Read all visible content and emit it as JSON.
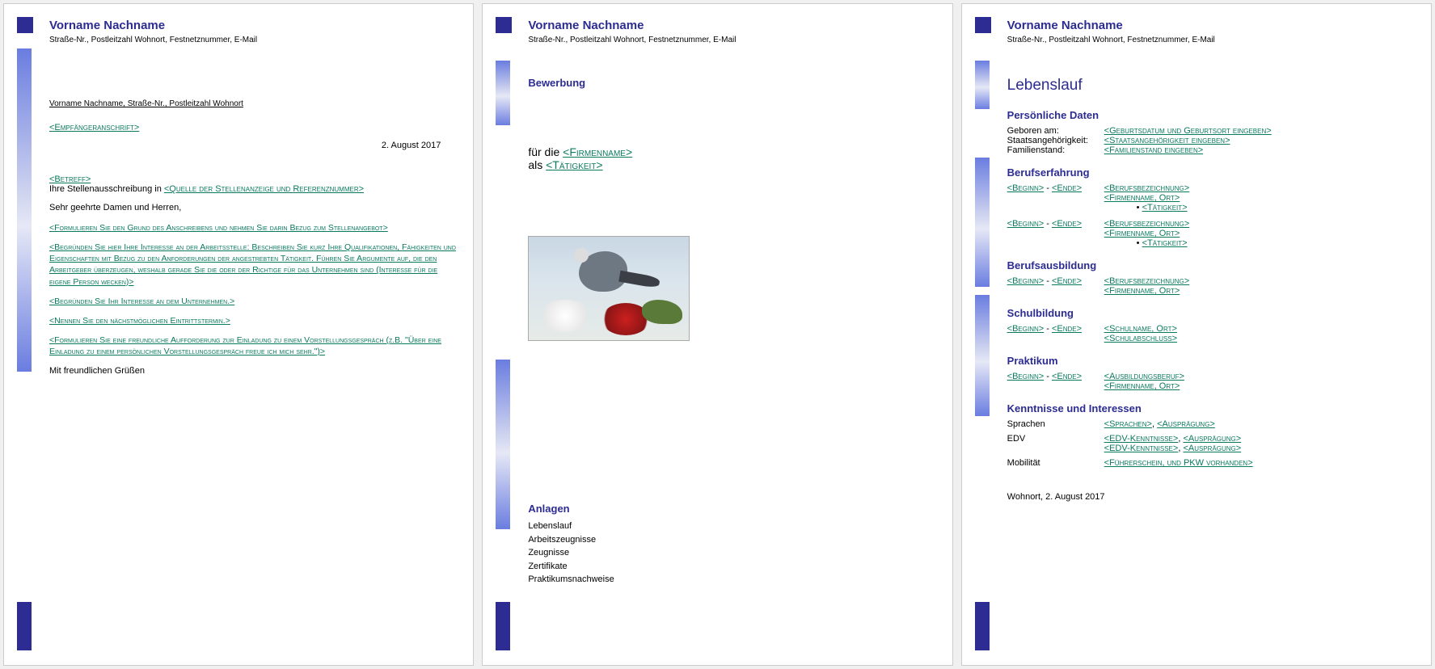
{
  "header": {
    "name": "Vorname Nachname",
    "address": "Straße-Nr., Postleitzahl  Wohnort, Festnetznummer, E-Mail"
  },
  "page1": {
    "sender_line": "Vorname Nachname, Straße-Nr., Postleitzahl  Wohnort",
    "recipient": "<Empfängeranschrift>",
    "date": "2. August 2017",
    "subject": "<Betreff>",
    "subject_line_prefix": "Ihre Stellenausschreibung in ",
    "subject_source": "<Quelle der Stellenanzeige und Referenznummer>",
    "salutation": "Sehr geehrte Damen und Herren,",
    "p1": "<Formulieren Sie den Grund des Anschreibens und nehmen Sie darin Bezug zum Stellenangebot>",
    "p2": "<Begründen Sie hier Ihre Interesse an der Arbeitsstelle: Beschreiben Sie kurz Ihre Qualifikationen, Fähigkeiten und Eigenschaften mit Bezug zu den Anforderungen der angestrebten Tätigkeit. Führen Sie Argumente auf, die den Arbeitgeber überzeugen, weshalb gerade Sie die oder der Richtige für das Unternehmen sind (Interesse für die eigene Person wecken)>",
    "p3": "<Begründen Sie Ihr Interesse an dem Unternehmen.>",
    "p4": "<Nennen Sie den nächstmöglichen Eintrittstermin.>",
    "p5": "<Formulieren Sie eine freundliche Aufforderung zur Einladung zu einem Vorstellungsgespräch (z.B. \"Über eine Einladung zu einem persönlichen Vorstellungsgespräch freue ich mich sehr.\")>",
    "closing": "Mit freundlichen Grüßen"
  },
  "page2": {
    "title": "Bewerbung",
    "for_prefix": "für die ",
    "company": "<Firmenname>",
    "as_prefix": "als ",
    "activity": "<Tätigkeit>",
    "attachments_title": "Anlagen",
    "attachments": [
      "Lebenslauf",
      "Arbeitszeugnisse",
      "Zeugnisse",
      "Zertifikate",
      "Praktikumsnachweise"
    ]
  },
  "page3": {
    "title": "Lebenslauf",
    "s_personal": "Persönliche Daten",
    "born_label": "Geboren am:",
    "born_val": "<Geburtsdatum und Geburtsort eingeben>",
    "nation_label": "Staatsangehörigkeit:",
    "nation_val": "<Staatsangehörigkeit eingeben>",
    "family_label": "Familienstand:",
    "family_val": "<Familienstand eingeben>",
    "s_experience": "Berufserfahrung",
    "beg": "<Beginn>",
    "end": "<Ende>",
    "dash": " - ",
    "job_title": "<Berufsbezeichnung>",
    "company_loc": "<Firmenname, Ort>",
    "activity": "<Tätigkeit>",
    "s_training": "Berufsausbildung",
    "s_school": "Schulbildung",
    "school_name": "<Schulname, Ort>",
    "school_degree": "<Schulabschluss>",
    "s_intern": "Praktikum",
    "intern_job": "<Ausbildungsberuf>",
    "s_skills": "Kenntnisse und Interessen",
    "lang_label": "Sprachen",
    "lang_val1": "<Sprachen>",
    "level": "<Ausprägung>",
    "edv_label": "EDV",
    "edv_val": "<EDV-Kenntnisse>",
    "mobility_label": "Mobilität",
    "mobility_val": "<Führerschein, und PKW vorhanden>",
    "footer": "Wohnort, 2. August 2017",
    "comma": ", "
  }
}
